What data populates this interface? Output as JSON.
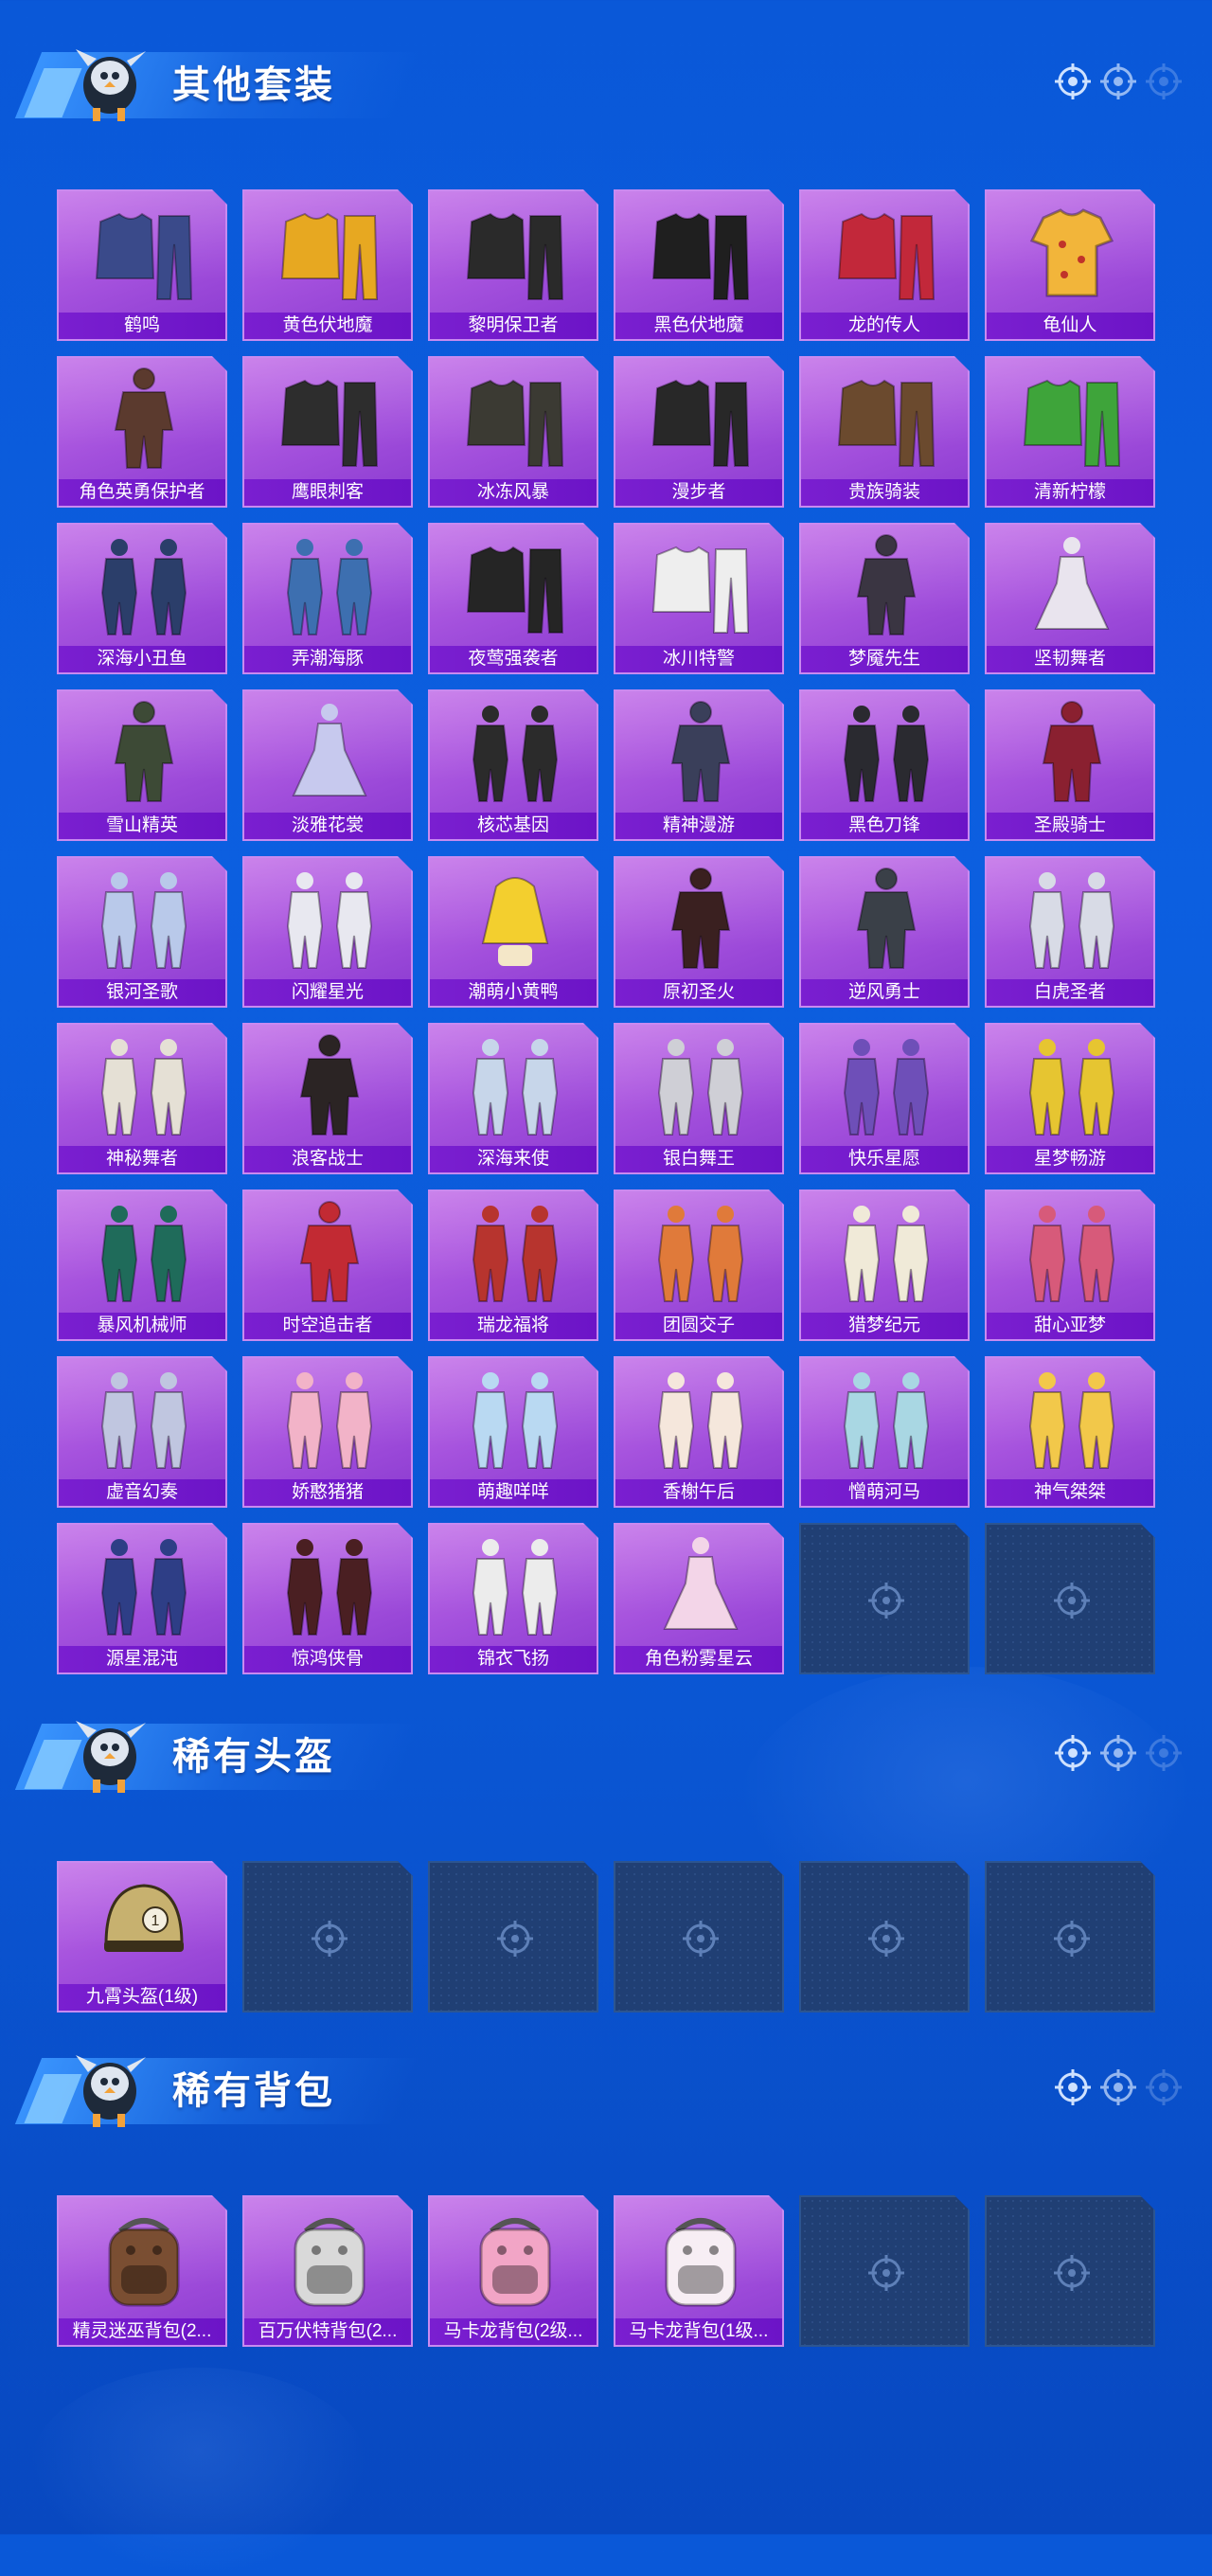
{
  "colors": {
    "background": "#0c5fe0",
    "card_purple": "#a24fdc",
    "label_purple": "#6c14c7",
    "empty_slot": "#203f74"
  },
  "sections": {
    "suits": {
      "title": "其他套装",
      "items": [
        {
          "name": "鹤鸣",
          "icon": "hoodie-icon",
          "color": "#3a4a8a"
        },
        {
          "name": "黄色伏地魔",
          "icon": "hoodie-pants-icon",
          "color": "#e7a821"
        },
        {
          "name": "黎明保卫者",
          "icon": "jacket-pants-icon",
          "color": "#2a2a2a"
        },
        {
          "name": "黑色伏地魔",
          "icon": "hoodie-pants-icon",
          "color": "#1f1f1f"
        },
        {
          "name": "龙的传人",
          "icon": "robe-icon",
          "color": "#c2283a"
        },
        {
          "name": "龟仙人",
          "icon": "shirt-icon",
          "color": "#f2b53a"
        },
        {
          "name": "角色英勇保护者",
          "icon": "armor-figure-icon",
          "color": "#5b3a2e"
        },
        {
          "name": "鹰眼刺客",
          "icon": "hooded-jacket-icon",
          "color": "#2d2d2d"
        },
        {
          "name": "冰冻风暴",
          "icon": "jacket-pants-icon",
          "color": "#3b3a33"
        },
        {
          "name": "漫步者",
          "icon": "jacket-pants-icon",
          "color": "#282828"
        },
        {
          "name": "贵族骑装",
          "icon": "vest-pants-icon",
          "color": "#6b4a2e"
        },
        {
          "name": "清新柠檬",
          "icon": "jacket-pants-icon",
          "color": "#3ea43a"
        },
        {
          "name": "深海小丑鱼",
          "icon": "two-figures-icon",
          "color": "#2b3e6a"
        },
        {
          "name": "弄潮海豚",
          "icon": "two-figures-icon",
          "color": "#3d6fb0"
        },
        {
          "name": "夜莺强袭者",
          "icon": "jacket-pants-icon",
          "color": "#252525"
        },
        {
          "name": "冰川特警",
          "icon": "jacket-pants-icon",
          "color": "#eeeeee"
        },
        {
          "name": "梦魇先生",
          "icon": "coat-figure-icon",
          "color": "#3a3542"
        },
        {
          "name": "坚韧舞者",
          "icon": "dress-icon",
          "color": "#e9e4ee"
        },
        {
          "name": "雪山精英",
          "icon": "coat-figure-icon",
          "color": "#3d4a36"
        },
        {
          "name": "淡雅花裳",
          "icon": "dress-icon",
          "color": "#c7c9ee"
        },
        {
          "name": "核芯基因",
          "icon": "two-figures-icon",
          "color": "#2b2b2b"
        },
        {
          "name": "精神漫游",
          "icon": "armor-figure-icon",
          "color": "#3a3f5a"
        },
        {
          "name": "黑色刀锋",
          "icon": "two-figures-icon",
          "color": "#2a2a30"
        },
        {
          "name": "圣殿骑士",
          "icon": "armor-figure-icon",
          "color": "#8a2030"
        },
        {
          "name": "银河圣歌",
          "icon": "two-figures-icon",
          "color": "#b9c9ea"
        },
        {
          "name": "闪耀星光",
          "icon": "two-figures-icon",
          "color": "#e8e8f0"
        },
        {
          "name": "潮萌小黄鸭",
          "icon": "raincoat-icon",
          "color": "#f3cf2e"
        },
        {
          "name": "原初圣火",
          "icon": "armor-figure-icon",
          "color": "#3a2020"
        },
        {
          "name": "逆风勇士",
          "icon": "armor-figure-icon",
          "color": "#3a4048"
        },
        {
          "name": "白虎圣者",
          "icon": "two-figures-icon",
          "color": "#d8dbe6"
        },
        {
          "name": "神秘舞者",
          "icon": "two-figures-icon",
          "color": "#e5e0d5"
        },
        {
          "name": "浪客战士",
          "icon": "coat-figure-icon",
          "color": "#2b2424"
        },
        {
          "name": "深海来使",
          "icon": "two-figures-icon",
          "color": "#c7d6ea"
        },
        {
          "name": "银白舞王",
          "icon": "two-figures-icon",
          "color": "#cfcfd6"
        },
        {
          "name": "快乐星愿",
          "icon": "two-figures-icon",
          "color": "#6e4fb8"
        },
        {
          "name": "星梦畅游",
          "icon": "two-figures-icon",
          "color": "#e6c531"
        },
        {
          "name": "暴风机械师",
          "icon": "two-figures-icon",
          "color": "#1f6b5a"
        },
        {
          "name": "时空追击者",
          "icon": "armor-figure-icon",
          "color": "#c22a33"
        },
        {
          "name": "瑞龙福将",
          "icon": "two-figures-icon",
          "color": "#b7342e"
        },
        {
          "name": "团圆交子",
          "icon": "two-figures-icon",
          "color": "#e07a3a"
        },
        {
          "name": "猎梦纪元",
          "icon": "two-figures-icon",
          "color": "#f0ead8"
        },
        {
          "name": "甜心亚梦",
          "icon": "two-figures-icon",
          "color": "#d75a7a"
        },
        {
          "name": "虚音幻奏",
          "icon": "two-figures-icon",
          "color": "#c0c6e0"
        },
        {
          "name": "娇憨猪猪",
          "icon": "two-figures-icon",
          "color": "#f2b3c8"
        },
        {
          "name": "萌趣咩咩",
          "icon": "two-figures-icon",
          "color": "#b9d9f2"
        },
        {
          "name": "香榭午后",
          "icon": "two-figures-icon",
          "color": "#f5e7dc"
        },
        {
          "name": "憎萌河马",
          "icon": "two-figures-icon",
          "color": "#a9d7e3"
        },
        {
          "name": "神气桀桀",
          "icon": "two-figures-icon",
          "color": "#f2c84a"
        },
        {
          "name": "源星混沌",
          "icon": "two-figures-icon",
          "color": "#2e3e86"
        },
        {
          "name": "惊鸿侠骨",
          "icon": "two-figures-icon",
          "color": "#4a1f22"
        },
        {
          "name": "锦衣飞扬",
          "icon": "two-figures-icon",
          "color": "#ececec"
        },
        {
          "name": "角色粉雾星云",
          "icon": "dress-figure-icon",
          "color": "#f3d5e8"
        }
      ],
      "empty_slots": 2
    },
    "helmets": {
      "title": "稀有头盔",
      "items": [
        {
          "name": "九霄头盔(1级)",
          "icon": "helmet-icon",
          "color": "#c7b16f"
        }
      ],
      "empty_slots": 5
    },
    "backpacks": {
      "title": "稀有背包",
      "items": [
        {
          "name": "精灵迷巫背包(2...",
          "icon": "backpack-icon",
          "color": "#7a4e32"
        },
        {
          "name": "百万伏特背包(2...",
          "icon": "backpack-icon",
          "color": "#d9d9d9"
        },
        {
          "name": "马卡龙背包(2级...",
          "icon": "backpack-icon",
          "color": "#f2a5c6"
        },
        {
          "name": "马卡龙背包(1级...",
          "icon": "backpack-icon",
          "color": "#f7eef4"
        }
      ],
      "empty_slots": 2
    }
  }
}
